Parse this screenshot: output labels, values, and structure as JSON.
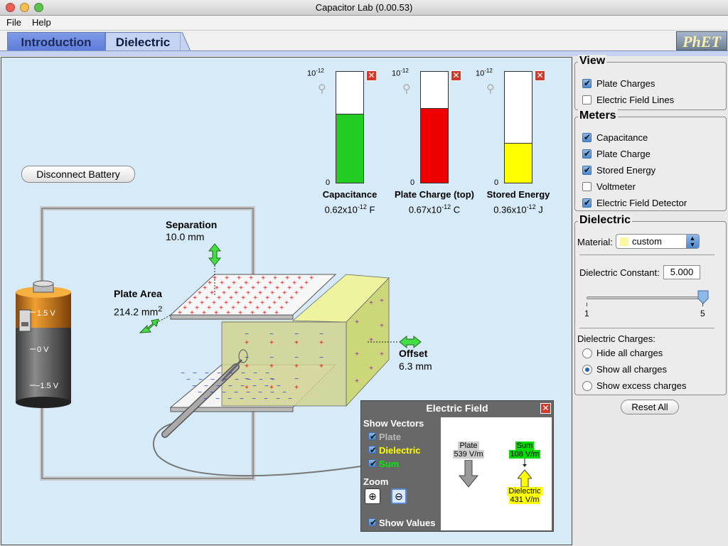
{
  "window": {
    "title": "Capacitor Lab (0.00.53)"
  },
  "menu": {
    "file": "File",
    "help": "Help"
  },
  "tabs": [
    {
      "label": "Introduction"
    },
    {
      "label": "Dielectric"
    }
  ],
  "logo": "PhET",
  "meters": [
    {
      "label": "Capacitance",
      "value": "0.62x10",
      "exp": "-12",
      "unit": "F",
      "scale_exp": "-12",
      "scale_zero": "0",
      "level": 0.62,
      "color": "#22cc22"
    },
    {
      "label": "Plate Charge (top)",
      "value": "0.67x10",
      "exp": "-12",
      "unit": "C",
      "scale_exp": "-12",
      "scale_zero": "0",
      "level": 0.67,
      "color": "#ee0000"
    },
    {
      "label": "Stored Energy",
      "value": "0.36x10",
      "exp": "-12",
      "unit": "J",
      "scale_exp": "-12",
      "scale_zero": "0",
      "level": 0.36,
      "color": "#ffff00"
    }
  ],
  "scene": {
    "disconnect_button": "Disconnect Battery",
    "separation_label": "Separation",
    "separation_value": "10.0 mm",
    "plate_area_label": "Plate Area",
    "plate_area_value": "214.2 mm",
    "plate_area_exp": "2",
    "offset_label": "Offset",
    "offset_value": "6.3 mm",
    "battery_labels": [
      "1.5 V",
      "0 V",
      "−1.5 V"
    ]
  },
  "efield": {
    "title": "Electric Field",
    "show_vectors": "Show Vectors",
    "plate": "Plate",
    "dielectric": "Dielectric",
    "sum": "Sum",
    "zoom": "Zoom",
    "show_values": "Show Values",
    "plate_value": "539 V/m",
    "sum_value": "108 V/m",
    "dielectric_value": "431 V/m",
    "plate_color": "#cfcfcf",
    "sum_color": "#00dd00",
    "dielectric_color": "#ffff00"
  },
  "view": {
    "title": "View",
    "plate_charges": "Plate Charges",
    "field_lines": "Electric Field Lines"
  },
  "meters_panel": {
    "title": "Meters",
    "capacitance": "Capacitance",
    "plate_charge": "Plate Charge",
    "stored_energy": "Stored Energy",
    "voltmeter": "Voltmeter",
    "field_detector": "Electric Field Detector"
  },
  "dielectric": {
    "title": "Dielectric",
    "material_label": "Material:",
    "material_value": "custom",
    "material_color": "#f8f8a0",
    "constant_label": "Dielectric Constant:",
    "constant_value": "5.000",
    "slider_min": "1",
    "slider_max": "5",
    "charges_label": "Dielectric Charges:",
    "hide": "Hide all charges",
    "show_all": "Show all charges",
    "show_excess": "Show excess charges"
  },
  "reset": "Reset All"
}
